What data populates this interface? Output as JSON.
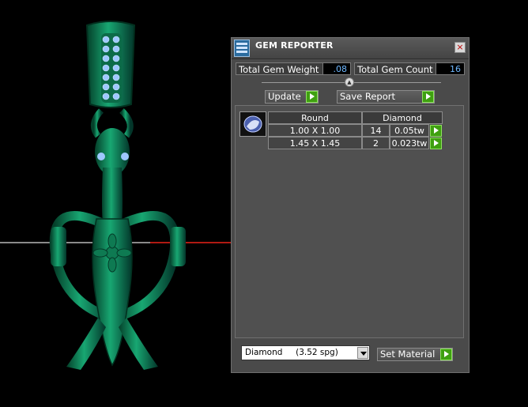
{
  "panel": {
    "title": "GEM REPORTER",
    "close_glyph": "×"
  },
  "stats": {
    "total_weight_label": "Total Gem Weight",
    "total_weight_value": ".08",
    "total_count_label": "Total Gem Count",
    "total_count_value": "16"
  },
  "slider": {
    "knob_glyph": "▲"
  },
  "buttons": {
    "update": "Update",
    "save_report": "Save Report",
    "set_material": "Set Material"
  },
  "table": {
    "headers": [
      "Round",
      "Diamond"
    ],
    "rows": [
      {
        "size": "1.00 X 1.00",
        "count": "14",
        "weight": "0.05tw"
      },
      {
        "size": "1.45 X 1.45",
        "count": "2",
        "weight": "0.023tw"
      }
    ]
  },
  "material_select": {
    "value": "Diamond     (3.52 spg)"
  },
  "colors": {
    "model_green": "#0b8a5c",
    "panel_bg": "#4a4a4a",
    "value_text": "#6fb8ff",
    "arrow_green": "#3fa010",
    "axis_red": "#b01a12"
  },
  "icons": [
    "gem-reporter-icon",
    "close-icon",
    "arrow-right-icon",
    "dropdown-chevron-icon",
    "round-gem-icon",
    "slider-knob-icon"
  ]
}
